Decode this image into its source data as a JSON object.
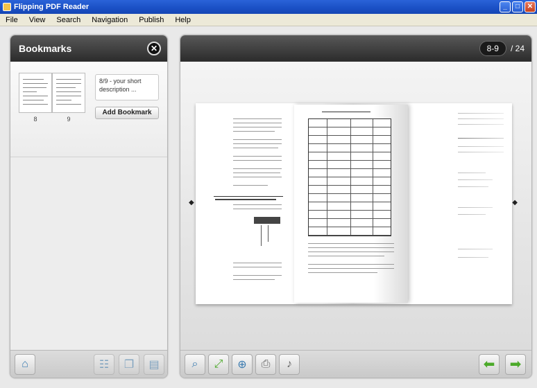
{
  "window": {
    "title": "Flipping PDF Reader"
  },
  "menu": [
    "File",
    "View",
    "Search",
    "Navigation",
    "Publish",
    "Help"
  ],
  "bookmarks": {
    "title": "Bookmarks",
    "thumb_pages": [
      "8",
      "9"
    ],
    "description": "8/9 - your short description ...",
    "add_label": "Add Bookmark"
  },
  "pager": {
    "current": "8-9",
    "total": "/ 24"
  },
  "icons": {
    "close": "close-icon",
    "home": "home-icon",
    "tree": "tree-icon",
    "copy": "copy-pages-icon",
    "add_page": "add-page-icon",
    "find": "binoculars-icon",
    "fullscreen": "fullscreen-icon",
    "zoom": "zoom-icon",
    "print": "print-icon",
    "sound": "sound-icon",
    "prev": "arrow-left-icon",
    "next": "arrow-right-icon"
  }
}
